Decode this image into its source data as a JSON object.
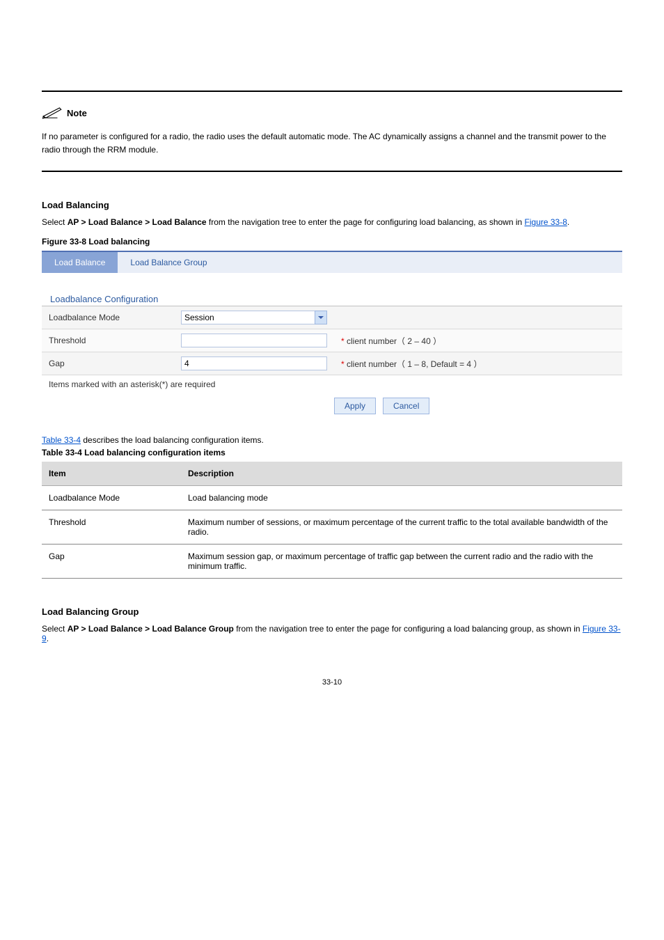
{
  "note": {
    "label": "Note",
    "body": "If no parameter is configured for a radio, the radio uses the default automatic mode. The AC dynamically assigns a channel and the transmit power to the radio through the RRM module."
  },
  "section1": {
    "title": "Load Balancing",
    "lead": "Select",
    "nav": "AP > Load Balance > Load Balance",
    "tail": " from the navigation tree to enter the page for configuring load balancing, as shown in ",
    "figref": "Figure 33-8",
    "figcap": "Figure 33-8 Load balancing"
  },
  "widget": {
    "tab1": "Load Balance",
    "tab2": "Load Balance Group",
    "section_title": "Loadbalance Configuration",
    "row1_label": "Loadbalance Mode",
    "row1_value": "Session",
    "row2_label": "Threshold",
    "row2_value": "",
    "row2_hint_tail": " client number（ 2 – 40 ）",
    "row3_label": "Gap",
    "row3_value": "4",
    "row3_hint_tail": " client number（ 1 – 8, Default = 4 ）",
    "star": "*",
    "reqnote": "Items marked with an asterisk(*) are required",
    "apply": "Apply",
    "cancel": "Cancel"
  },
  "tbl": {
    "refsent": "Table 33-4",
    "refsent_tail": " describes the load balancing configuration items.",
    "caption": "Table 33-4 Load balancing configuration items",
    "h1": "Item",
    "h2": "Description",
    "r1c1": "Loadbalance Mode",
    "r1c2": "Load balancing mode",
    "r2c1": "Threshold",
    "r2c2": "Maximum number of sessions, or maximum percentage of the current traffic to the total available bandwidth of the radio.",
    "r3c1": "Gap",
    "r3c2": "Maximum session gap, or maximum percentage of traffic gap between the current radio and the radio with the minimum traffic."
  },
  "section2": {
    "title": "Load Balancing Group",
    "lead": "Select ",
    "nav": "AP > Load Balance > Load Balance Group",
    "tail": " from the navigation tree to enter the page for configuring a load balancing group, as shown in ",
    "figref": "Figure 33-9"
  },
  "pagenum": "33-10"
}
